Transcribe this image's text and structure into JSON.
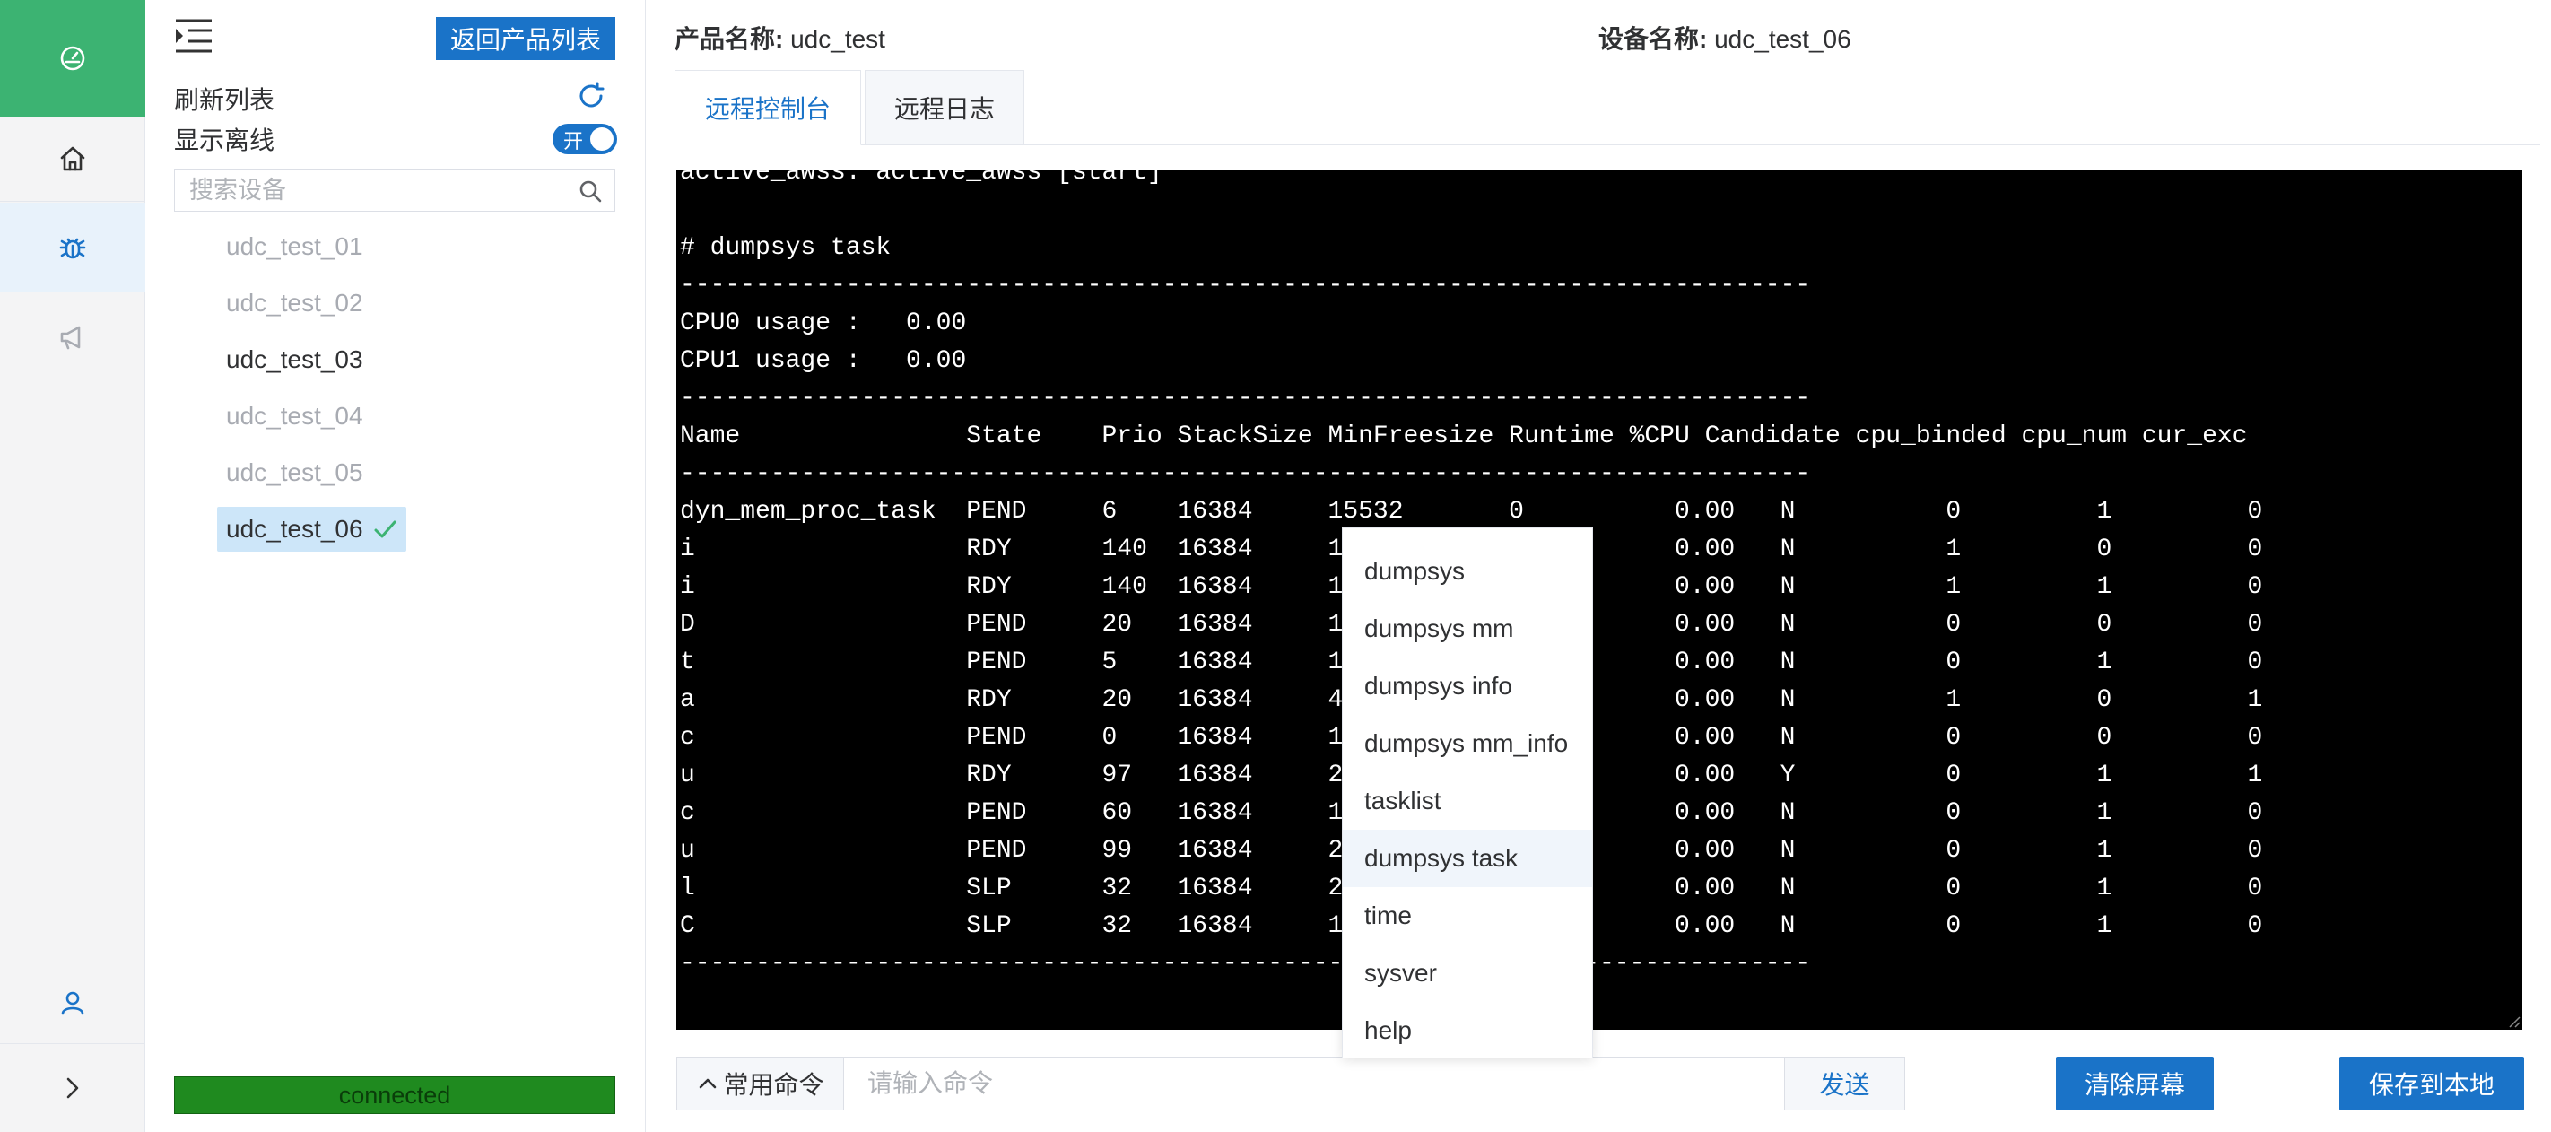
{
  "rail": {
    "icons": [
      "dashboard-icon",
      "home-icon",
      "debug-icon",
      "announce-icon",
      "user-icon",
      "expand-icon"
    ],
    "active_color": "#3cb372",
    "selected_color": "#1a73c8"
  },
  "panel": {
    "back_label": "返回产品列表",
    "refresh_label": "刷新列表",
    "show_offline_label": "显示离线",
    "toggle_text": "开",
    "toggle_on": true,
    "search_placeholder": "搜索设备",
    "devices": [
      {
        "name": "udc_test_01",
        "status": "offline"
      },
      {
        "name": "udc_test_02",
        "status": "offline"
      },
      {
        "name": "udc_test_03",
        "status": "online"
      },
      {
        "name": "udc_test_04",
        "status": "offline"
      },
      {
        "name": "udc_test_05",
        "status": "offline"
      },
      {
        "name": "udc_test_06",
        "status": "selected"
      }
    ],
    "connection_status": "connected",
    "connection_color": "#1f8a1f"
  },
  "main": {
    "product_label": "产品名称:",
    "product_value": "udc_test",
    "device_label": "设备名称:",
    "device_value": "udc_test_06",
    "tabs": [
      {
        "label": "远程控制台",
        "active": true
      },
      {
        "label": "远程日志",
        "active": false
      }
    ],
    "terminal_text": "active_awss: active_awss [start]\n\n# dumpsys task\n---------------------------------------------------------------------------\nCPU0 usage :   0.00\nCPU1 usage :   0.00\n---------------------------------------------------------------------------\nName               State    Prio StackSize MinFreesize Runtime %CPU Candidate cpu_binded cpu_num cur_exc\n---------------------------------------------------------------------------\ndyn_mem_proc_task  PEND     6    16384     15532       0          0.00   N          0         1         0\ni                  RDY      140  16384     14188       0          0.00   N          1         0         0\ni                  RDY      140  16384     13996       0          0.00   N          1         1         0\nD                  PEND     20   16384     15564       0          0.00   N          0         0         0\nt                  PEND     5    16384     13868       0          0.00   N          0         1         0\na                  RDY      20   16384     4632        0          0.00   N          1         0         1\nc                  PEND     0    16384     15740       0          0.00   N          0         0         0\nu                  RDY      97   16384     2972        0          0.00   Y          0         1         1\nc                  PEND     60   16384     15484       0          0.00   N          0         1         0\nu                  PEND     99   16384     2420        0          0.00   N          0         1         0\nl                  SLP      32   16384     2848        0          0.00   N          0         1         0\nC                  SLP      32   16384     13812       0          0.00   N          0         1         0\n---------------------------------------------------------------------------",
    "command_menu": [
      "dumpsys",
      "dumpsys mm",
      "dumpsys info",
      "dumpsys mm_info",
      "tasklist",
      "dumpsys task",
      "time",
      "sysver",
      "help"
    ],
    "command_menu_highlight": "dumpsys task",
    "common_cmd_label": "常用命令",
    "cmd_placeholder": "请输入命令",
    "send_label": "发送",
    "clear_label": "清除屏幕",
    "save_label": "保存到本地"
  }
}
